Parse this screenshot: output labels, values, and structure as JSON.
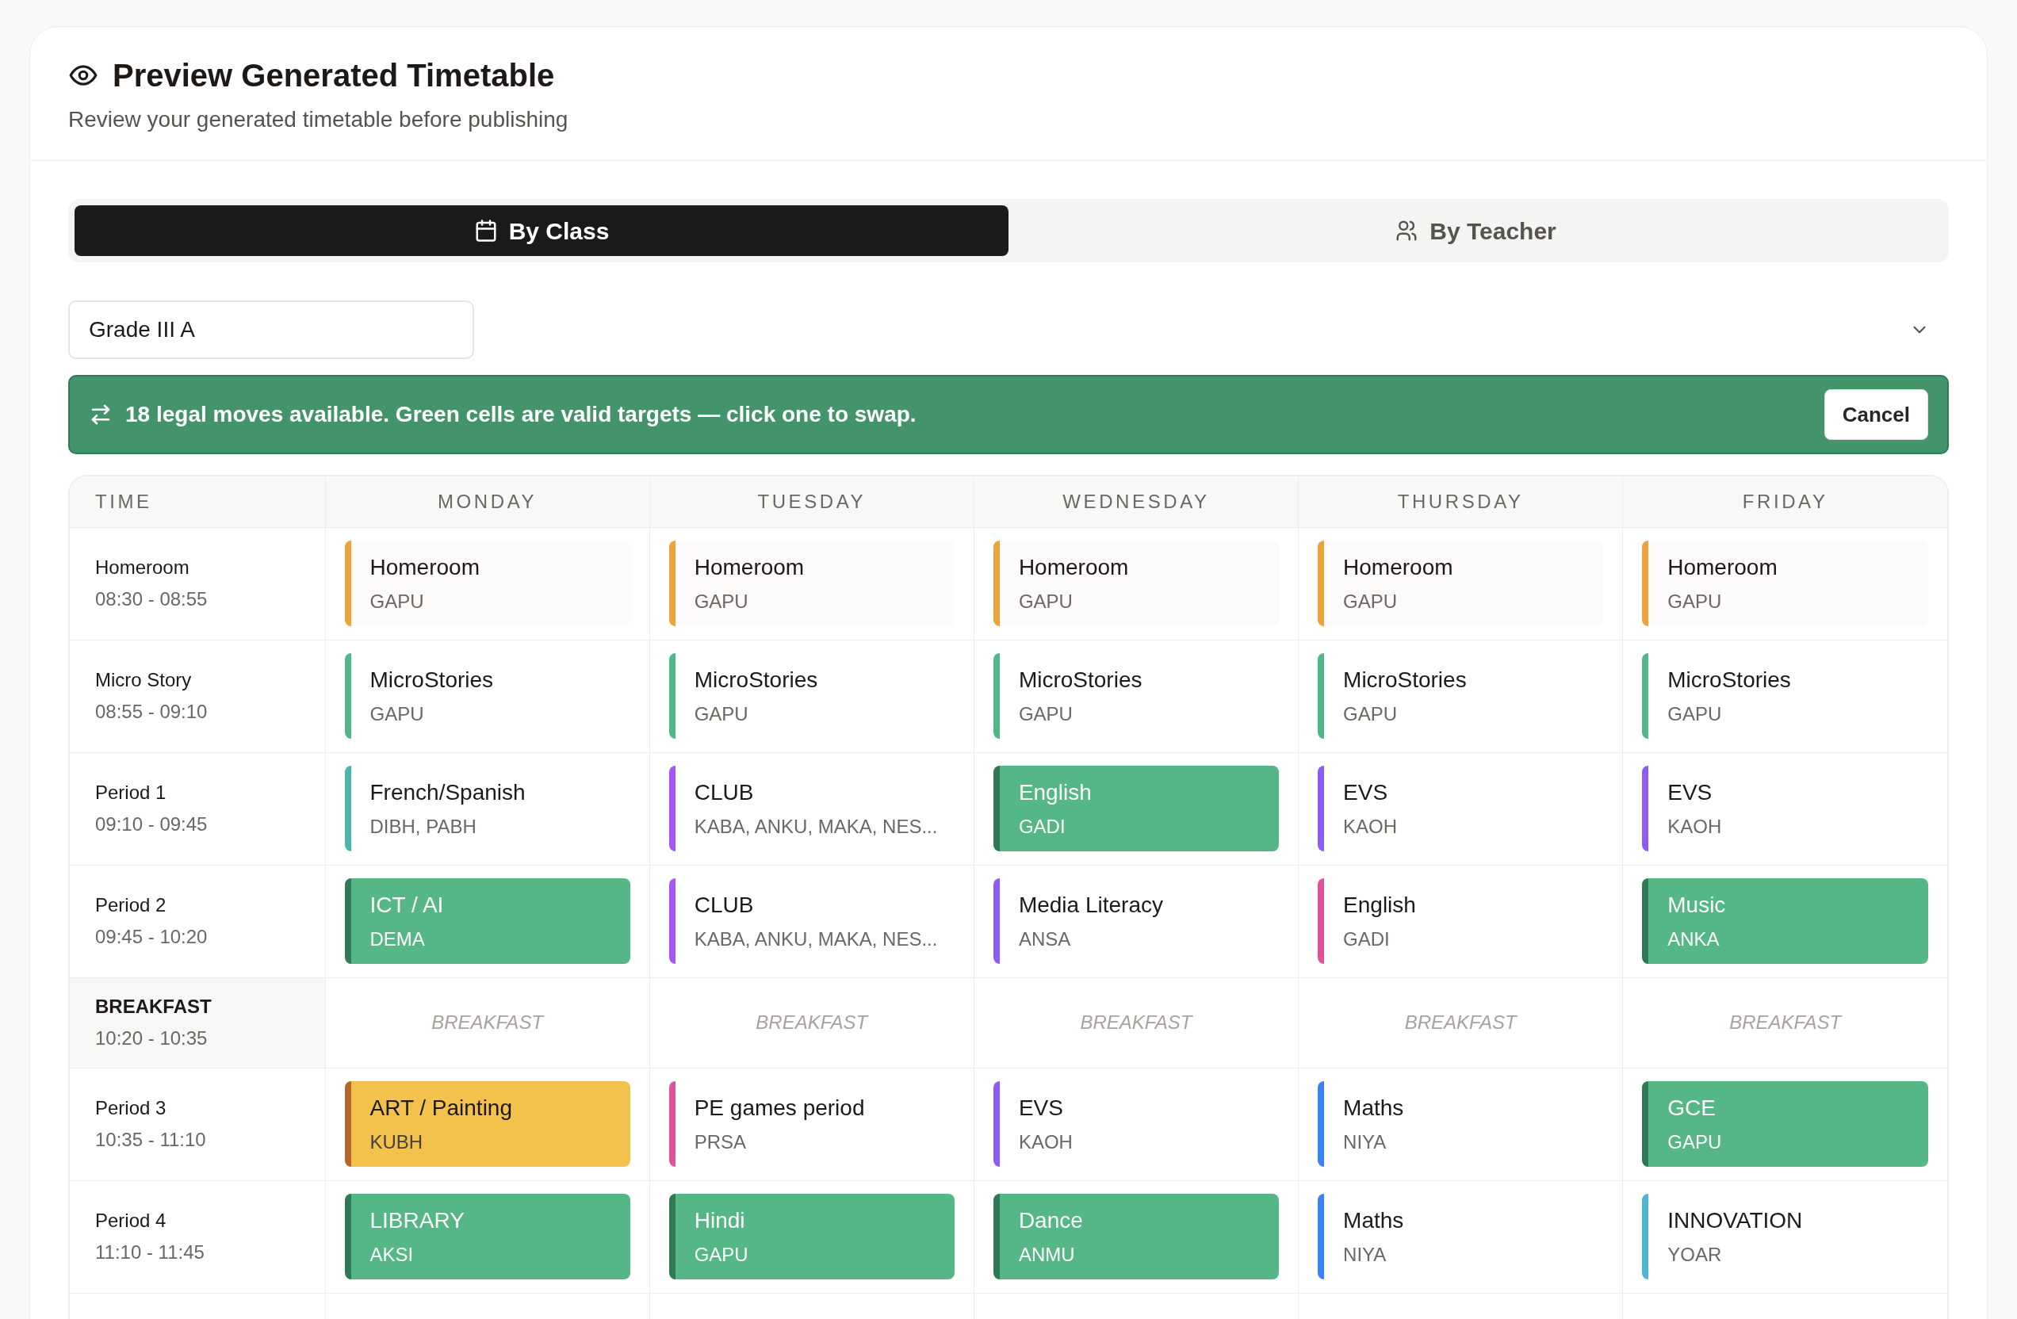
{
  "header": {
    "title": "Preview Generated Timetable",
    "subtitle": "Review your generated timetable before publishing"
  },
  "tabs": [
    {
      "label": "By Class",
      "selected": true
    },
    {
      "label": "By Teacher",
      "selected": false
    }
  ],
  "class_select": {
    "value": "Grade III A"
  },
  "banner": {
    "message": "18 legal moves available. Green cells are valid targets — click one to swap.",
    "button": "Cancel"
  },
  "table": {
    "time_header": "TIME",
    "columns": [
      "MONDAY",
      "TUESDAY",
      "WEDNESDAY",
      "THURSDAY",
      "FRIDAY"
    ],
    "rows": [
      {
        "kind": "lesson",
        "label": "Homeroom",
        "time": "08:30 - 08:55",
        "cells": [
          {
            "kind": "normal",
            "subject": "Homeroom",
            "teacher": "GAPU",
            "color": "#eea23c"
          },
          {
            "kind": "normal",
            "subject": "Homeroom",
            "teacher": "GAPU",
            "color": "#eea23c"
          },
          {
            "kind": "normal",
            "subject": "Homeroom",
            "teacher": "GAPU",
            "color": "#eea23c"
          },
          {
            "kind": "normal",
            "subject": "Homeroom",
            "teacher": "GAPU",
            "color": "#eea23c"
          },
          {
            "kind": "normal",
            "subject": "Homeroom",
            "teacher": "GAPU",
            "color": "#eea23c"
          }
        ]
      },
      {
        "kind": "lesson",
        "label": "Micro Story",
        "time": "08:55 - 09:10",
        "cells": [
          {
            "kind": "normal",
            "subject": "MicroStories",
            "teacher": "GAPU",
            "color": "#52b788"
          },
          {
            "kind": "normal",
            "subject": "MicroStories",
            "teacher": "GAPU",
            "color": "#52b788"
          },
          {
            "kind": "normal",
            "subject": "MicroStories",
            "teacher": "GAPU",
            "color": "#52b788"
          },
          {
            "kind": "normal",
            "subject": "MicroStories",
            "teacher": "GAPU",
            "color": "#52b788"
          },
          {
            "kind": "normal",
            "subject": "MicroStories",
            "teacher": "GAPU",
            "color": "#52b788"
          }
        ]
      },
      {
        "kind": "lesson",
        "label": "Period 1",
        "time": "09:10 - 09:45",
        "cells": [
          {
            "kind": "normal",
            "subject": "French/Spanish",
            "teacher": "DIBH, PABH",
            "color": "#4db6ac"
          },
          {
            "kind": "normal",
            "subject": "CLUB",
            "teacher": "KABA, ANKU, MAKA, NES...",
            "color": "#a855f7"
          },
          {
            "kind": "target",
            "subject": "English",
            "teacher": "GADI"
          },
          {
            "kind": "normal",
            "subject": "EVS",
            "teacher": "KAOH",
            "color": "#8b5cf6"
          },
          {
            "kind": "normal",
            "subject": "EVS",
            "teacher": "KAOH",
            "color": "#8b5cf6"
          }
        ]
      },
      {
        "kind": "lesson",
        "label": "Period 2",
        "time": "09:45 - 10:20",
        "cells": [
          {
            "kind": "target",
            "subject": "ICT / AI",
            "teacher": "DEMA"
          },
          {
            "kind": "normal",
            "subject": "CLUB",
            "teacher": "KABA, ANKU, MAKA, NES...",
            "color": "#a855f7"
          },
          {
            "kind": "normal",
            "subject": "Media Literacy",
            "teacher": "ANSA",
            "color": "#8b5cf6"
          },
          {
            "kind": "normal",
            "subject": "English",
            "teacher": "GADI",
            "color": "#e0529c"
          },
          {
            "kind": "target",
            "subject": "Music",
            "teacher": "ANKA"
          }
        ]
      },
      {
        "kind": "break",
        "label": "BREAKFAST",
        "time": "10:20 - 10:35",
        "cells": [
          {
            "text": "BREAKFAST"
          },
          {
            "text": "BREAKFAST"
          },
          {
            "text": "BREAKFAST"
          },
          {
            "text": "BREAKFAST"
          },
          {
            "text": "BREAKFAST"
          }
        ]
      },
      {
        "kind": "lesson",
        "label": "Period 3",
        "time": "10:35 - 11:10",
        "cells": [
          {
            "kind": "selected",
            "subject": "ART / Painting",
            "teacher": "KUBH",
            "color": "#b5652a"
          },
          {
            "kind": "normal",
            "subject": "PE games period",
            "teacher": "PRSA",
            "color": "#e0529c"
          },
          {
            "kind": "normal",
            "subject": "EVS",
            "teacher": "KAOH",
            "color": "#8b5cf6"
          },
          {
            "kind": "normal",
            "subject": "Maths",
            "teacher": "NIYA",
            "color": "#3b82f6"
          },
          {
            "kind": "target",
            "subject": "GCE",
            "teacher": "GAPU"
          }
        ]
      },
      {
        "kind": "lesson",
        "label": "Period 4",
        "time": "11:10 - 11:45",
        "cells": [
          {
            "kind": "target",
            "subject": "LIBRARY",
            "teacher": "AKSI"
          },
          {
            "kind": "target",
            "subject": "Hindi",
            "teacher": "GAPU"
          },
          {
            "kind": "target",
            "subject": "Dance",
            "teacher": "ANMU"
          },
          {
            "kind": "normal",
            "subject": "Maths",
            "teacher": "NIYA",
            "color": "#3b82f6"
          },
          {
            "kind": "normal",
            "subject": "INNOVATION",
            "teacher": "YOAR",
            "color": "#4ab8d6"
          }
        ]
      }
    ]
  }
}
